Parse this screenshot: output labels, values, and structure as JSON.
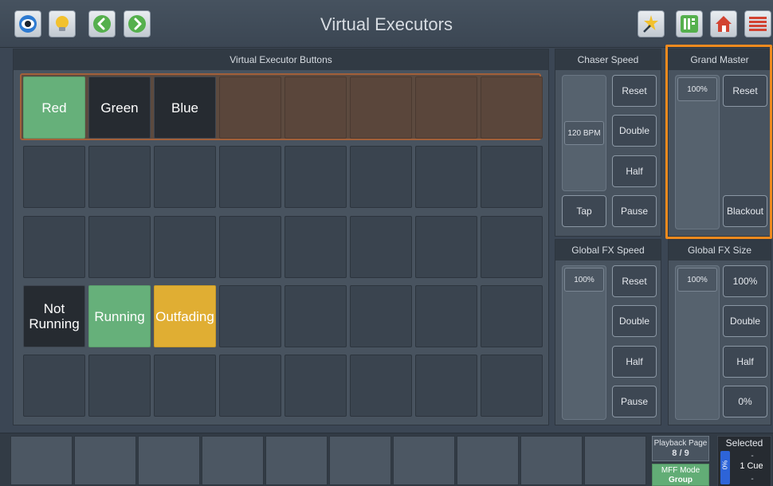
{
  "header": {
    "title": "Virtual Executors",
    "left_buttons": [
      {
        "icon": "eye-icon",
        "color": "#2d7ad1"
      },
      {
        "icon": "lightbulb-icon",
        "color": "#f2c12e"
      },
      {
        "icon": "chevron-left-icon",
        "color": "#55b04d"
      },
      {
        "icon": "chevron-right-icon",
        "color": "#55b04d"
      }
    ],
    "right_buttons": [
      {
        "icon": "magic-wand-icon",
        "color": "#f2c12e"
      },
      {
        "icon": "executor-sheet-icon",
        "color": "#55b04d"
      },
      {
        "icon": "home-icon",
        "color": "#d24331"
      },
      {
        "icon": "menu-icon",
        "color": "#d24331"
      }
    ]
  },
  "executor_buttons": {
    "header": "Virtual Executor Buttons",
    "rows": [
      [
        "Red",
        "Green",
        "Blue",
        "",
        "",
        "",
        "",
        ""
      ],
      [
        "",
        "",
        "",
        "",
        "",
        "",
        "",
        ""
      ],
      [
        "",
        "",
        "",
        "",
        "",
        "",
        "",
        ""
      ],
      [
        "Not Running",
        "Running",
        "Outfading",
        "",
        "",
        "",
        "",
        ""
      ],
      [
        "",
        "",
        "",
        "",
        "",
        "",
        "",
        ""
      ]
    ],
    "colors": {
      "red_cell": "#66b07a",
      "running": "#66b07a",
      "outfading": "#e0ae33",
      "not_running": "#262b31",
      "selected_row_border": "#a2603a"
    }
  },
  "chaser_speed": {
    "header": "Chaser Speed",
    "value": "120 BPM",
    "reset": "Reset",
    "double": "Double",
    "half": "Half",
    "tap": "Tap",
    "pause": "Pause"
  },
  "grand_master": {
    "header": "Grand Master",
    "value": "100%",
    "reset": "Reset",
    "blackout": "Blackout",
    "highlight_color": "#ef8a1e"
  },
  "global_fx_speed": {
    "header": "Global FX Speed",
    "value": "100%",
    "reset": "Reset",
    "double": "Double",
    "half": "Half",
    "pause": "Pause"
  },
  "global_fx_size": {
    "header": "Global FX Size",
    "value": "100%",
    "full": "100%",
    "double": "Double",
    "half": "Half",
    "zero": "0%"
  },
  "bottom": {
    "playback_page_label": "Playback Page",
    "playback_page_value": "8 / 9",
    "mff_label": "MFF Mode",
    "mff_value": "Group",
    "selected_title": "Selected",
    "selected_pct": "0%",
    "selected_dash_top": "-",
    "selected_cue": "1 Cue",
    "selected_dash_bottom": "-"
  }
}
